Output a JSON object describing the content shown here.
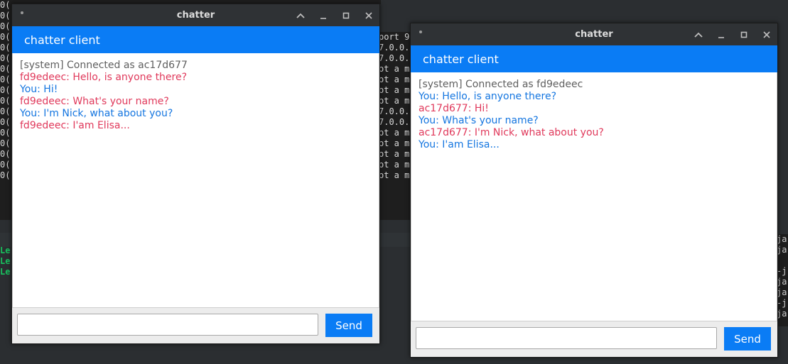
{
  "background": {
    "terminal_top_right_fragment": "port 9",
    "terminal_mid_lines": [
      "7.0.0.",
      "7.0.0.",
      "ot a m",
      "ot a m",
      "ot a m",
      "ot a m",
      "7.0.0.",
      "7.0.0.",
      "ot a m",
      "ot a m",
      "ot a m",
      "ot a m",
      "ot a m"
    ],
    "terminal_left_lines": [
      "0(",
      "0(",
      "0(",
      "0(",
      "0(",
      "0(",
      "0(",
      "0(",
      "0(",
      "0(",
      "0(",
      "0(",
      "0(",
      "0(",
      "0(",
      "0(",
      "0("
    ],
    "terminal_green_lines": [
      "Le",
      "Le",
      "Le"
    ],
    "terminal_right_lines": [
      "ja",
      "ja",
      "",
      "-j",
      "ja",
      "ja",
      "-j",
      "ja"
    ]
  },
  "windows": [
    {
      "title": "chatter",
      "header": "chatter client",
      "messages": [
        {
          "text": "[system] Connected as ac17d677",
          "kind": "sys"
        },
        {
          "text": "fd9edeec: Hello, is anyone there?",
          "kind": "other"
        },
        {
          "text": "You: Hi!",
          "kind": "you"
        },
        {
          "text": "fd9edeec: What's your name?",
          "kind": "other"
        },
        {
          "text": "You: I'm Nick, what about you?",
          "kind": "you"
        },
        {
          "text": "fd9edeec: I'am Elisa...",
          "kind": "other"
        }
      ],
      "input_value": "",
      "send_label": "Send"
    },
    {
      "title": "chatter",
      "header": "chatter client",
      "messages": [
        {
          "text": "[system] Connected as fd9edeec",
          "kind": "sys"
        },
        {
          "text": "You: Hello, is anyone there?",
          "kind": "you"
        },
        {
          "text": "ac17d677: Hi!",
          "kind": "other"
        },
        {
          "text": "You: What's your name?",
          "kind": "you"
        },
        {
          "text": "ac17d677: I'm Nick, what about you?",
          "kind": "other"
        },
        {
          "text": "You: I'am Elisa...",
          "kind": "you"
        }
      ],
      "input_value": "",
      "send_label": "Send"
    }
  ],
  "icons": {
    "window_menu": "menu-dot-icon",
    "shade": "chevron-up-icon",
    "minimize": "minimize-icon",
    "maximize": "maximize-icon",
    "close": "close-icon"
  },
  "colors": {
    "accent": "#0a7cf5",
    "you_message": "#1576e0",
    "other_message": "#e0395b",
    "system_message": "#5f5f5f"
  }
}
